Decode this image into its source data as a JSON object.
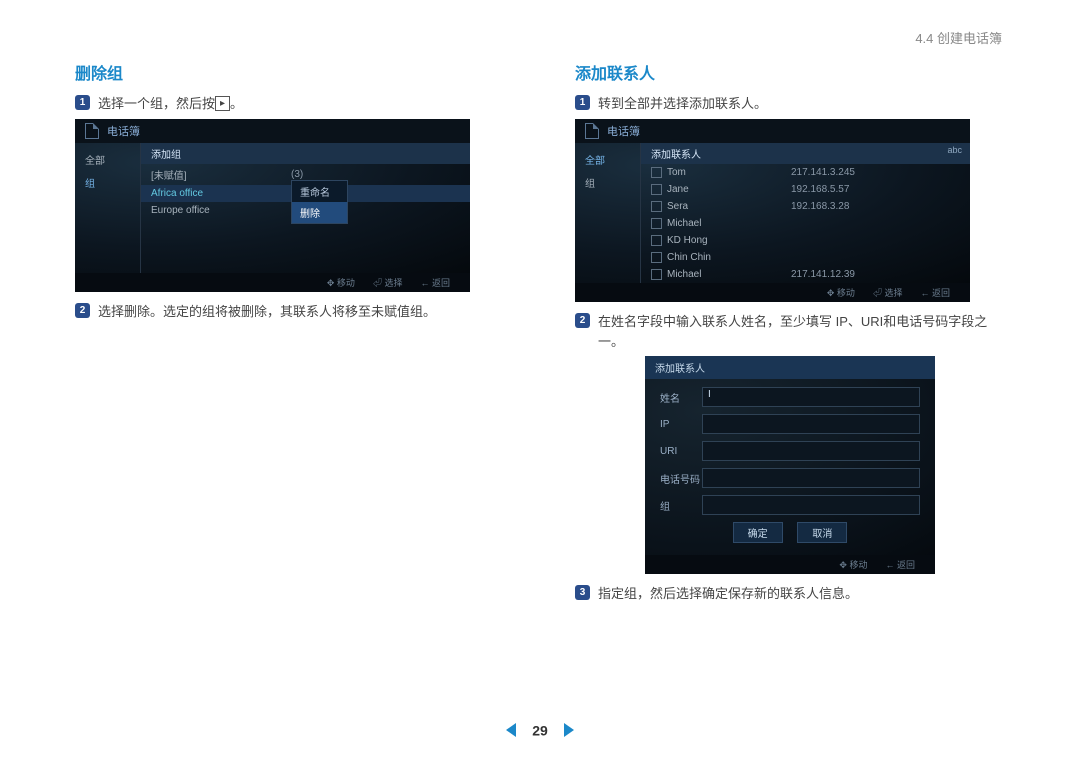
{
  "header": {
    "section_ref": "4.4 创建电话簿"
  },
  "left": {
    "title": "删除组",
    "step1": {
      "text_before_key": "选择一个组，然后按",
      "key_hint": "▸",
      "text_after_key": "。"
    },
    "step2": "选择删除。选定的组将被删除，其联系人将移至未赋值组。",
    "shot1": {
      "titlebar": "电话簿",
      "side_all": "全部",
      "side_group": "组",
      "header_row": "添加组",
      "rows": [
        {
          "name": "[未赋值]",
          "count": "(3)"
        },
        {
          "name": "Africa office",
          "highlight": true
        },
        {
          "name": "Europe office"
        }
      ],
      "ctx_rename": "重命名",
      "ctx_delete": "删除",
      "footer_move": "移动",
      "footer_select": "选择",
      "footer_back": "返回"
    }
  },
  "right": {
    "title": "添加联系人",
    "step1": "转到全部并选择添加联系人。",
    "step2": "在姓名字段中输入联系人姓名，至少填写 IP、URI和电话号码字段之一。",
    "step3": "指定组，然后选择确定保存新的联系人信息。",
    "shot1": {
      "titlebar": "电话簿",
      "side_all": "全部",
      "side_group": "组",
      "header_row": "添加联系人",
      "abc": "abc",
      "contacts": [
        {
          "name": "Tom",
          "ip": "217.141.3.245"
        },
        {
          "name": "Jane",
          "ip": "192.168.5.57"
        },
        {
          "name": "Sera",
          "ip": "192.168.3.28"
        },
        {
          "name": "Michael",
          "ip": ""
        },
        {
          "name": "KD Hong",
          "ip": ""
        },
        {
          "name": "Chin Chin",
          "ip": ""
        },
        {
          "name": "Michael",
          "ip": "217.141.12.39"
        }
      ],
      "footer_move": "移动",
      "footer_select": "选择",
      "footer_back": "返回"
    },
    "shot2": {
      "header": "添加联系人",
      "field_name": "姓名",
      "field_ip": "IP",
      "field_uri": "URI",
      "field_phone": "电话号码",
      "field_group": "组",
      "value_name": "I",
      "btn_ok": "确定",
      "btn_cancel": "取消",
      "footer_move": "移动",
      "footer_back": "返回"
    }
  },
  "pager": {
    "number": "29"
  }
}
